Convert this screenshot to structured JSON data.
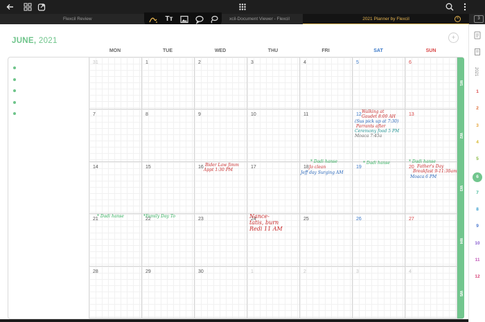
{
  "toolbar": {
    "back_icon": "arrow-left-icon",
    "grid_icon": "grid-icon",
    "export_icon": "share-icon",
    "apps_icon": "apps-icon",
    "search_icon": "search-icon",
    "more_icon": "more-vertical-icon"
  },
  "tabs": [
    {
      "label": "Flexcil Review"
    },
    {
      "label": "xcil-Document Viewer - Flexcil"
    },
    {
      "label": "2021 Planner by Flexcil"
    }
  ],
  "tab_count": "3",
  "pen_tools": [
    "pen-icon",
    "text-icon",
    "image-icon",
    "comment-icon",
    "lasso-icon"
  ],
  "planner": {
    "month": "JUNE,",
    "year": " 2021",
    "day_headers": [
      "MON",
      "TUE",
      "WED",
      "THU",
      "FRI",
      "SAT",
      "SUN"
    ],
    "weeks": [
      [
        "31",
        "1",
        "2",
        "3",
        "4",
        "5",
        "6"
      ],
      [
        "7",
        "8",
        "9",
        "10",
        "11",
        "12",
        "13"
      ],
      [
        "14",
        "15",
        "16",
        "17",
        "18",
        "19",
        "20"
      ],
      [
        "21",
        "22",
        "23",
        "24",
        "25",
        "26",
        "27"
      ],
      [
        "28",
        "29",
        "30",
        "1",
        "2",
        "3",
        "4"
      ]
    ],
    "week_labels": [
      "W1",
      "W2",
      "W3",
      "W4",
      "W5"
    ]
  },
  "handwriting": {
    "w2_sat_1": "Walking at",
    "w2_sat_2": "Gaudet 8:00 AH",
    "w2_sat_3": "(Sus pick up at 7:30)",
    "w2_sat_4": "Parrants after",
    "w2_sat_5": "Ceremony food 5 PM",
    "w2_sat_6": "Moaca 7:45a",
    "w3_wed_1": "Bider Law Jimm",
    "w3_wed_2": "Appt 1:30 PM",
    "w3_fri_1": "* Dadi hanse",
    "w3_fri_2": "Jo clean",
    "w3_fri_3": "Jeff day Surging AM",
    "w3_sat_1": "* Dadi hanse",
    "w3_sun_1": "* Dadi hanse",
    "w3_sun_2": "Father's Day",
    "w3_sun_3": "Breakfast 9-11:30am",
    "w3_sun_4": "Moaca 6 PM",
    "w4_mon_1": "* Dadi hanse",
    "w4_tue_1": "*Family Day To",
    "w4_thu_1": "Nance-",
    "w4_thu_2": "tatis, burn",
    "w4_thu_3": "Redi 11 AM"
  },
  "sidebar": {
    "add_icon": "new-page-icon",
    "pages_icon": "pages-icon",
    "year": "2021",
    "months": [
      "1",
      "2",
      "3",
      "4",
      "5",
      "6",
      "7",
      "8",
      "9",
      "10",
      "11",
      "12"
    ],
    "current_month": "6",
    "month_colors": [
      "#d94545",
      "#e0703a",
      "#e6a335",
      "#d7b82e",
      "#86b83e",
      "#72c68e",
      "#3fb89a",
      "#3a9fcf",
      "#4a78d0",
      "#8a5fd0",
      "#c256b8",
      "#d9457a"
    ]
  }
}
